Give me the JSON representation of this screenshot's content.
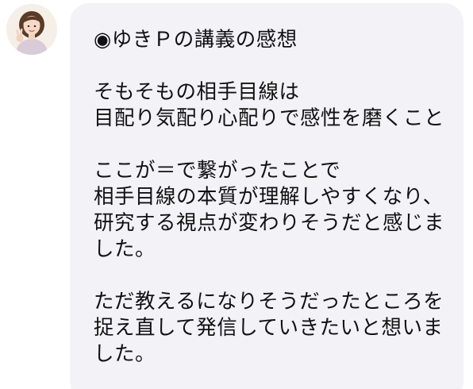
{
  "header": {
    "fragment_text": ""
  },
  "message": {
    "title": "◉ゆきＰの講義の感想",
    "paragraphs": [
      [
        "そもそもの相手目線は",
        "目配り気配り心配りで感性を磨くこと"
      ],
      [
        "ここが＝で繋がったことで",
        "相手目線の本質が理解しやすくなり、",
        "研究する視点が変わりそうだと感じま",
        "した。"
      ],
      [
        "ただ教えるになりそうだったところを",
        "捉え直して発信していきたいと想いま",
        "した。"
      ]
    ]
  },
  "colors": {
    "bubble": "#f2f2f7",
    "text": "#111111",
    "background": "#ffffff"
  },
  "icons": {
    "avatar": "user-avatar-photo"
  }
}
